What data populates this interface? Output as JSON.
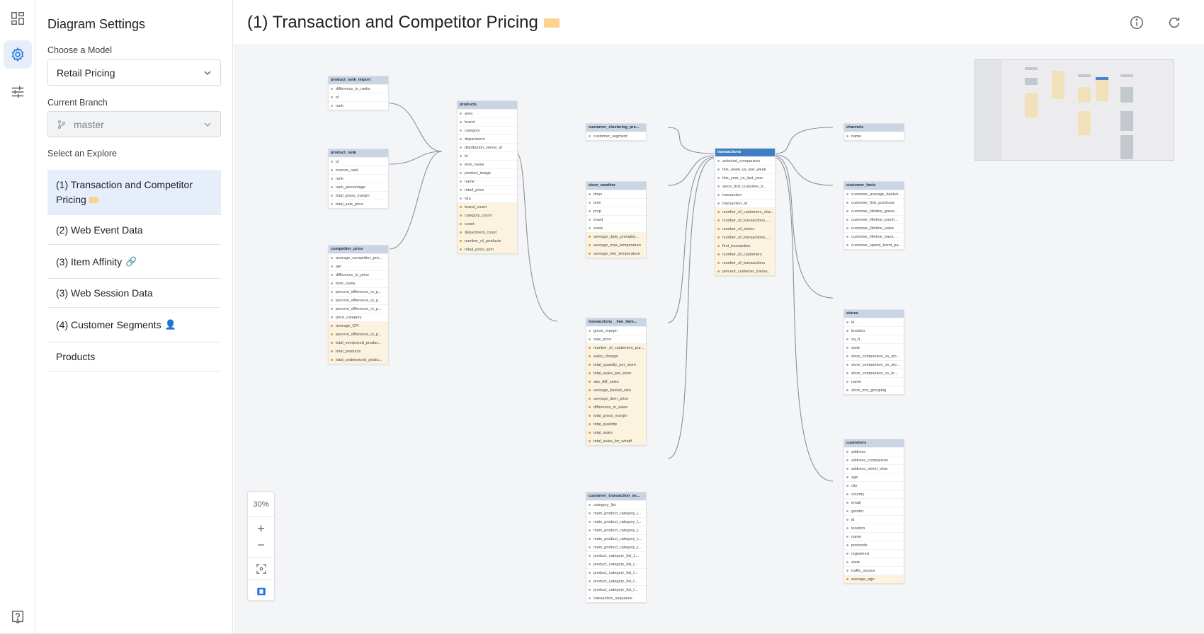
{
  "rail": {
    "items": [
      {
        "icon": "grid-icon"
      },
      {
        "icon": "gear-icon",
        "active": true
      },
      {
        "icon": "sliders-icon"
      }
    ],
    "help_icon": "help-icon"
  },
  "panel": {
    "title": "Diagram Settings",
    "model_label": "Choose a Model",
    "model_value": "Retail Pricing",
    "branch_label": "Current Branch",
    "branch_value": "master",
    "explore_label": "Select an Explore",
    "explores": [
      {
        "label": "(1) Transaction and Competitor Pricing",
        "active": true
      },
      {
        "label": "(2) Web Event Data"
      },
      {
        "label": "(3) Item Affinity"
      },
      {
        "label": "(3) Web Session Data"
      },
      {
        "label": "(4) Customer Segments"
      },
      {
        "label": "Products"
      }
    ]
  },
  "header": {
    "title": "(1) Transaction and Competitor Pricing",
    "info_icon": "info-icon",
    "refresh_icon": "refresh-icon"
  },
  "zoom": {
    "level": "30%"
  },
  "diagram": {
    "tables": [
      {
        "name": "product_rank_import",
        "fields": [
          "difference_in_ranks",
          "id",
          "rank"
        ]
      },
      {
        "name": "product_rank",
        "fields": [
          "id",
          "inverse_rank",
          "rank",
          "rank_percentage",
          "total_gross_margin",
          "total_sale_price"
        ]
      },
      {
        "name": "competitor_price",
        "fields": [
          "average_competitor_pric...",
          "apr",
          "difference_in_price",
          "item_name",
          "percent_difference_in_p...",
          "percent_difference_in_p...",
          "percent_difference_in_p...",
          "price_category",
          "average_CPI",
          "percent_difference_in_p...",
          "total_overpriced_produc...",
          "total_products",
          "total_underpriced_produ..."
        ]
      },
      {
        "name": "products",
        "fields": [
          "area",
          "brand",
          "category",
          "department",
          "distribution_venue_id",
          "id",
          "item_name",
          "product_image",
          "name",
          "retail_price",
          "sku",
          "brand_count",
          "category_count",
          "count",
          "department_count",
          "number_of_products",
          "retail_price_sum"
        ]
      },
      {
        "name": "customer_clustering_pre...",
        "fields": [
          "customer_segment"
        ]
      },
      {
        "name": "store_weather",
        "fields": [
          "tmax",
          "tmin",
          "prcp",
          "snwd",
          "snow",
          "average_daily_precipita...",
          "average_max_temperature",
          "average_min_temperature"
        ]
      },
      {
        "name": "transactions__line_item...",
        "fields": [
          "gross_margin",
          "sale_price",
          "number_of_customers_pur...",
          "sales_change",
          "total_quantity_per_store",
          "total_sales_per_store",
          "abs_diff_sales",
          "average_basket_size",
          "average_item_price",
          "difference_in_sales",
          "total_gross_margin",
          "total_quantity",
          "total_sales",
          "total_sales_for_whatif"
        ]
      },
      {
        "name": "customer_transaction_se...",
        "fields": [
          "category_list",
          "main_product_category_l...",
          "main_product_category_l...",
          "main_product_category_t...",
          "main_product_category_t...",
          "main_product_category_t...",
          "product_category_list_1...",
          "product_category_list_t...",
          "product_category_list_t...",
          "product_category_list_t...",
          "product_category_list_t...",
          "transaction_sequence"
        ]
      },
      {
        "name": "transactions",
        "fields": [
          "selected_comparison",
          "this_week_vs_last_week",
          "this_year_vs_last_year",
          "since_first_customer_tr...",
          "transaction",
          "transaction_id",
          "number_of_customers_cha...",
          "number_of_transactions_...",
          "number_of_stores",
          "number_of_transactions_...",
          "first_transaction",
          "number_of_customers",
          "number_of_transactions",
          "percent_customer_transa..."
        ]
      },
      {
        "name": "channels",
        "fields": [
          "name"
        ]
      },
      {
        "name": "customer_facts",
        "fields": [
          "customer_average_basket...",
          "customer_first_purchase",
          "customer_lifetime_gross...",
          "customer_lifetime_purch...",
          "customer_lifetime_sales",
          "customer_lifetime_trans...",
          "customer_spend_trend_pa..."
        ]
      },
      {
        "name": "stores",
        "fields": [
          "id",
          "location",
          "sq_ft",
          "state",
          "store_comparison_vs_sto...",
          "store_comparison_vs_sto...",
          "store_comparison_vs_te...",
          "name",
          "store_mix_grouping"
        ]
      },
      {
        "name": "customers",
        "fields": [
          "address",
          "address_comparison",
          "address_street_view",
          "age",
          "city",
          "country",
          "email",
          "gender",
          "id",
          "location",
          "name",
          "postcode",
          "registered",
          "state",
          "traffic_source",
          "average_age"
        ]
      }
    ]
  }
}
